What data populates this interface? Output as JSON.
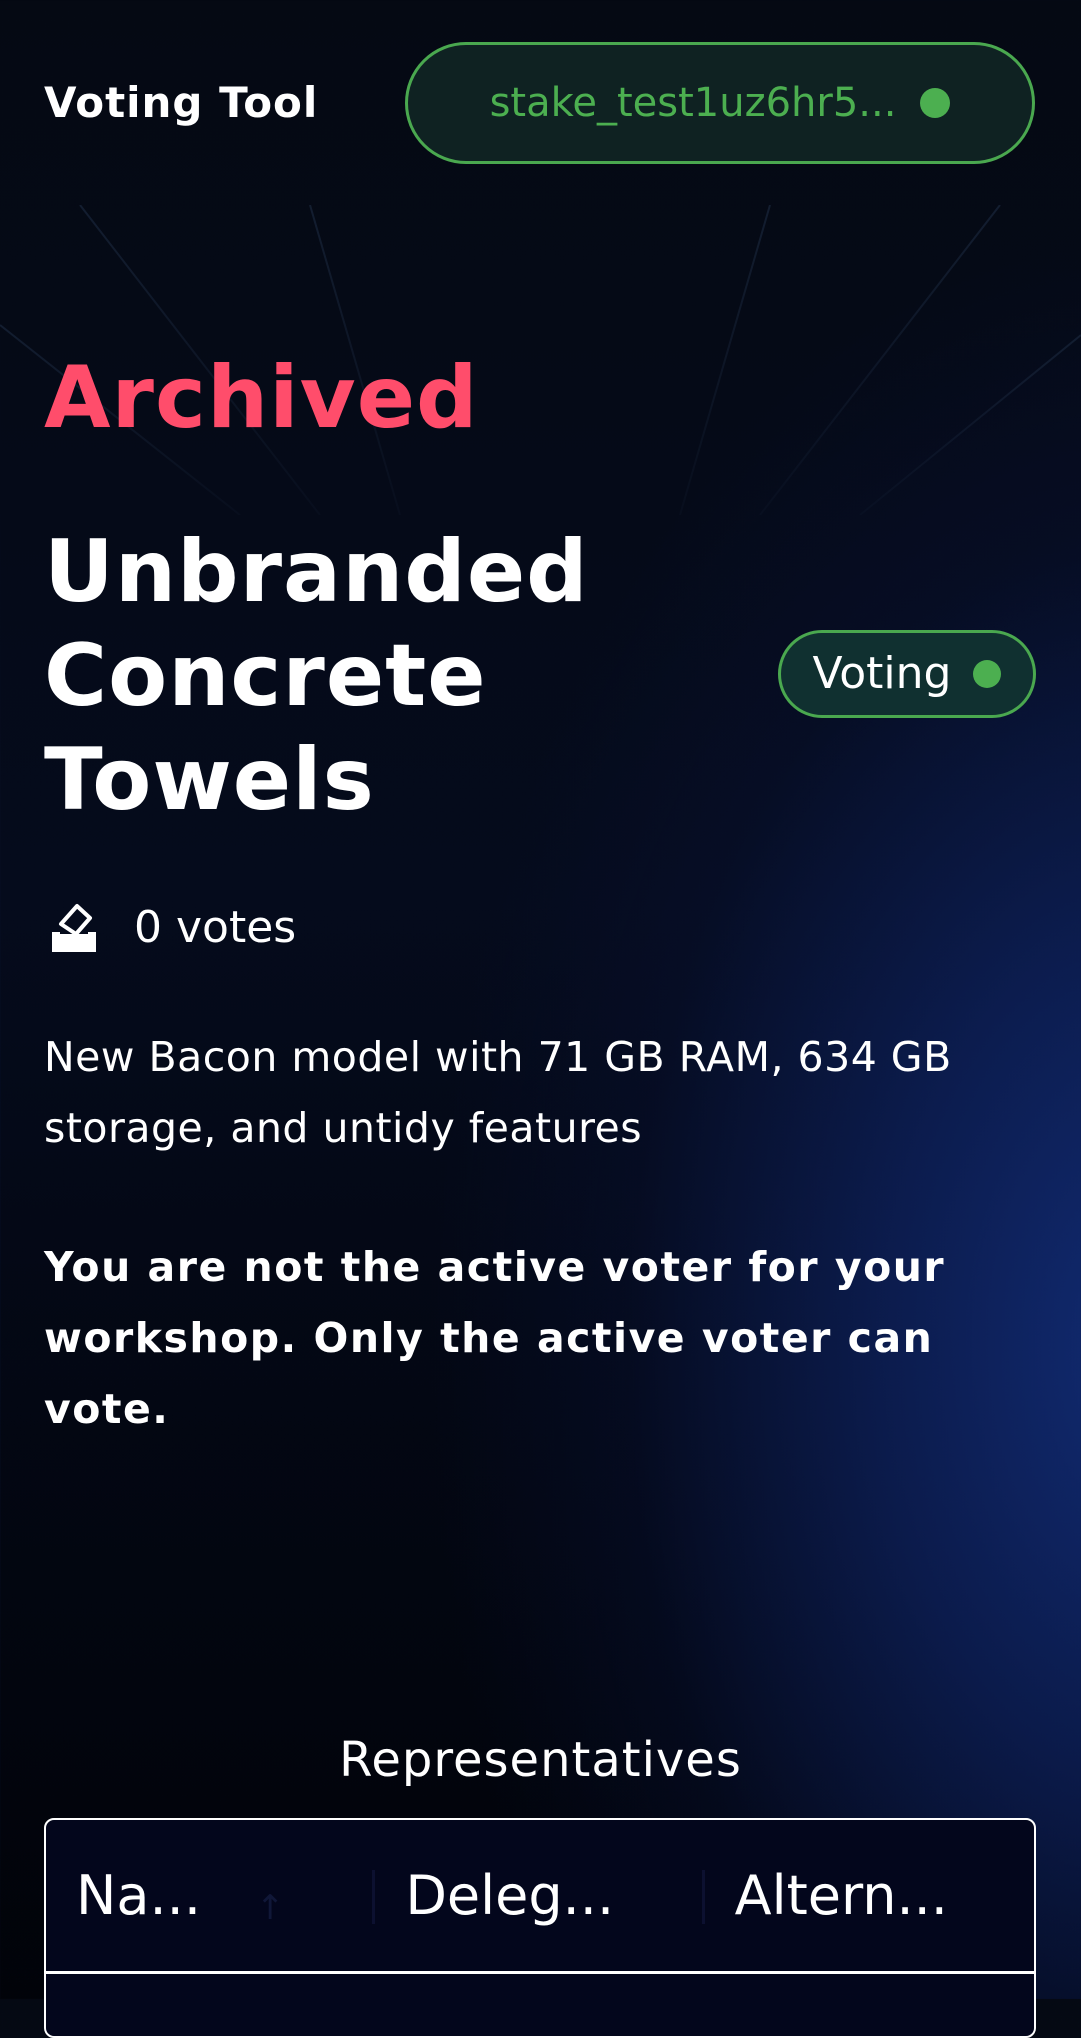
{
  "header": {
    "app_title": "Voting Tool",
    "wallet_address": "stake_test1uz6hr5...",
    "wallet_status_icon": "connected-dot-icon"
  },
  "proposal": {
    "status_label": "Archived",
    "title": "Unbranded Concrete Towels",
    "phase_badge": "Voting",
    "votes_icon": "ballot-box-icon",
    "votes_text": "0 votes",
    "description": "New Bacon model with 71 GB RAM, 634 GB storage, and untidy features",
    "voter_notice": "You are not the active voter for your workshop. Only the active voter can vote."
  },
  "representatives": {
    "heading": "Representatives",
    "columns": [
      "Na...",
      "Deleg...",
      "Altern..."
    ]
  },
  "colors": {
    "accent_green": "#4caf50",
    "archived_red": "#ff4d6b",
    "background": "#050b1c"
  }
}
